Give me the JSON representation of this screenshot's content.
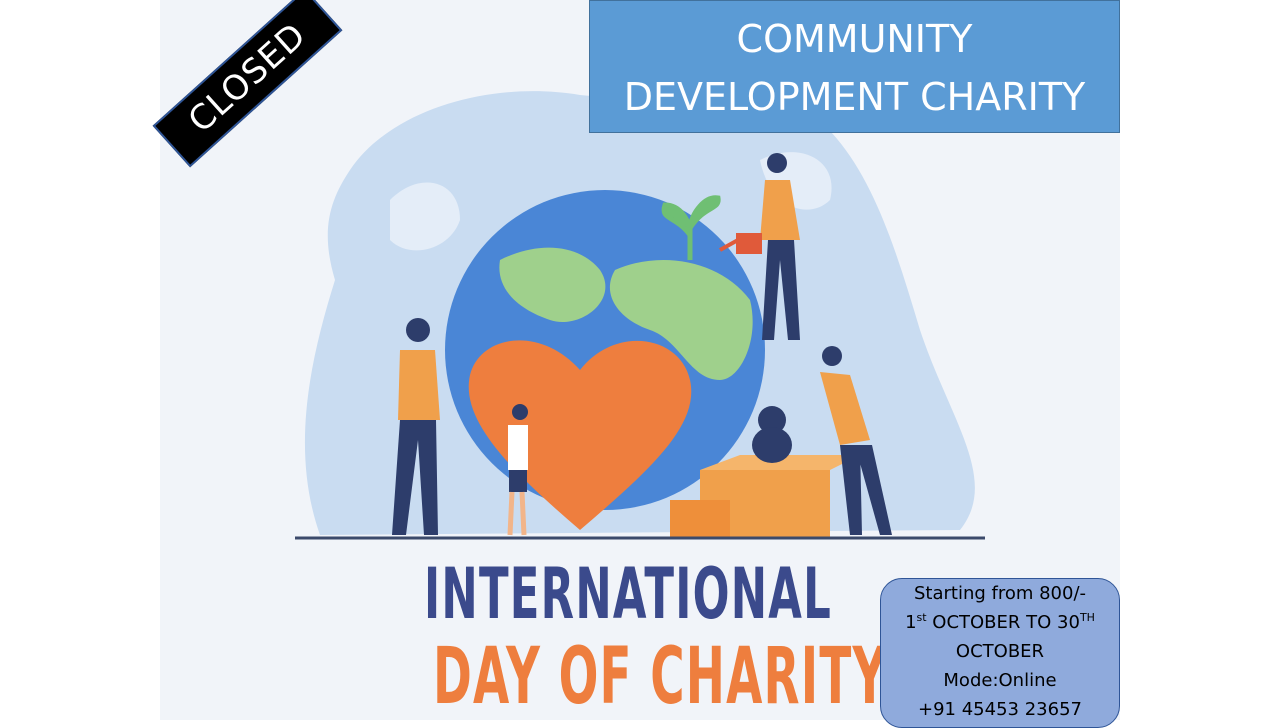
{
  "banner": {
    "line1": "COMMUNITY",
    "line2": "DEVELOPMENT CHARITY"
  },
  "ribbon": {
    "label": "CLOSED"
  },
  "hero": {
    "line1": "INTERNATIONAL",
    "line2": "DAY OF CHARITY"
  },
  "info": {
    "price": "Starting from 800/-",
    "dates_start_num": "1",
    "dates_start_sup": "st",
    "dates_mid": " OCTOBER TO 30",
    "dates_end_sup": "TH",
    "dates_line2": "OCTOBER",
    "mode": "Mode:Online",
    "phone": "+91 45453 23657"
  },
  "colors": {
    "banner_bg": "#5b9bd5",
    "info_bg": "#8faadc",
    "hero_blue": "#3b4a8c",
    "hero_orange": "#ee7e3e",
    "ribbon_bg": "#000000"
  },
  "illustration": {
    "icons": [
      "globe-icon",
      "heart-icon",
      "donation-box-icon",
      "teddy-bear-icon",
      "watering-can-icon",
      "plant-icon"
    ]
  }
}
